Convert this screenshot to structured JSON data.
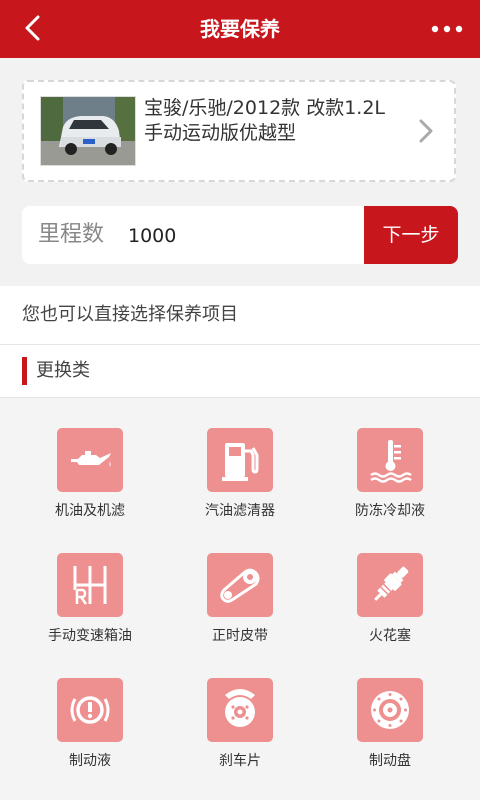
{
  "header": {
    "title": "我要保养"
  },
  "car": {
    "name": "宝骏/乐驰/2012款 改款1.2L 手动运动版优越型"
  },
  "mileage": {
    "label": "里程数",
    "value": "1000",
    "next_label": "下一步"
  },
  "direct_select": "您也可以直接选择保养项目",
  "section": {
    "title": "更换类"
  },
  "items": [
    {
      "label": "机油及机滤",
      "icon": "oil-can-icon"
    },
    {
      "label": "汽油滤清器",
      "icon": "fuel-pump-icon"
    },
    {
      "label": "防冻冷却液",
      "icon": "coolant-icon"
    },
    {
      "label": "手动变速箱油",
      "icon": "gear-shift-icon"
    },
    {
      "label": "正时皮带",
      "icon": "timing-belt-icon"
    },
    {
      "label": "火花塞",
      "icon": "spark-plug-icon"
    },
    {
      "label": "制动液",
      "icon": "brake-fluid-icon"
    },
    {
      "label": "刹车片",
      "icon": "brake-pad-icon"
    },
    {
      "label": "制动盘",
      "icon": "brake-disc-icon"
    }
  ],
  "colors": {
    "brand": "#c8161d",
    "tile": "#ee8f90"
  }
}
